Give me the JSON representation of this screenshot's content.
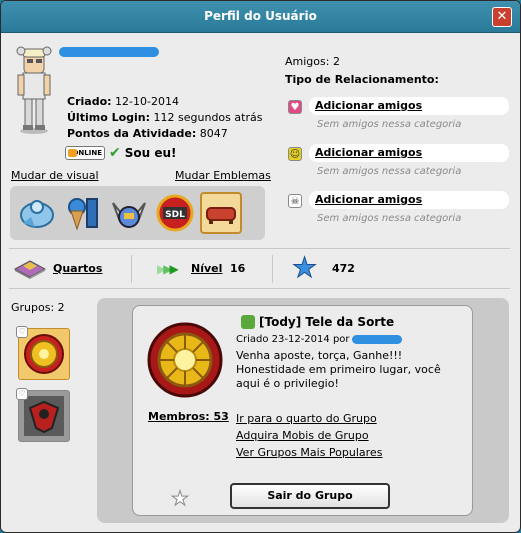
{
  "window": {
    "title": "Perfil do Usuário",
    "close": "✕"
  },
  "profile": {
    "created_label": "Criado:",
    "created_value": "12-10-2014",
    "login_label": "Último Login:",
    "login_value": "112 segundos atrás",
    "points_label": "Pontos da Atividade:",
    "points_value": "8047",
    "online_badge": "ONLINE",
    "its_me": "Sou eu!"
  },
  "links": {
    "change_look": "Mudar de visual",
    "change_badges": "Mudar Emblemas"
  },
  "friends": {
    "count_label": "Amigos: 2",
    "relationship_title": "Tipo de Relacionamento:",
    "relations": [
      {
        "icon": "heart-icon",
        "add": "Adicionar amigos",
        "empty": "Sem amigos nessa categoria"
      },
      {
        "icon": "smile-icon",
        "add": "Adicionar amigos",
        "empty": "Sem amigos nessa categoria"
      },
      {
        "icon": "skull-icon",
        "add": "Adicionar amigos",
        "empty": "Sem amigos nessa categoria"
      }
    ]
  },
  "stats": {
    "rooms_label": "Quartos",
    "level_label": "Nível",
    "level_value": "16",
    "stars_value": "472"
  },
  "groups": {
    "label": "Grupos: 2",
    "selected": {
      "title": "[Tody] Tele da Sorte",
      "created": "Criado 23-12-2014 por",
      "description": "Venha aposte, torça, Ganhe!!! Honestidade em primeiro lugar, você aqui é o privilegio!",
      "members": "Membros: 53",
      "links": [
        "Ir para o quarto do Grupo",
        "Adquira Mobis de Grupo",
        "Ver Grupos Mais Populares"
      ],
      "leave_button": "Sair do Grupo"
    }
  },
  "colors": {
    "titlebar": "#2a7a9a",
    "close": "#c9412e",
    "panel": "#c9c9c9",
    "redaction": "#2f8fe0"
  }
}
